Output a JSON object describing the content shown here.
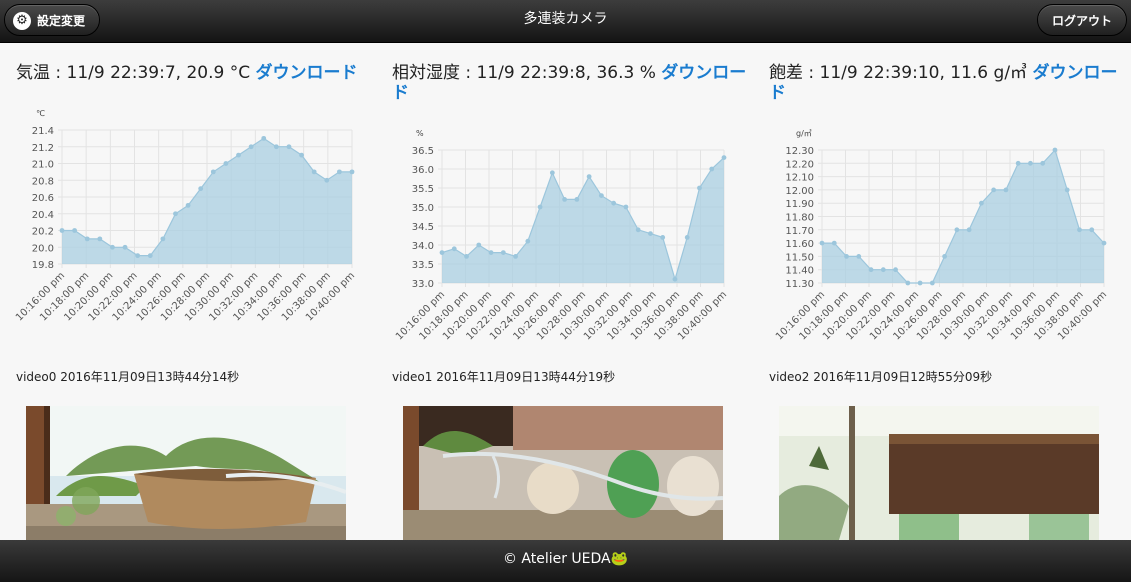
{
  "header": {
    "title": "多連装カメラ",
    "settings_label": "設定変更",
    "settings_icon": "gear-icon",
    "logout_label": "ログアウト"
  },
  "panels": [
    {
      "heading": "気温 : 11/9 22:39:7, 20.9 °C",
      "download_label": "ダウンロード",
      "video_label": "video0 2016年11月09日13時44分14秒"
    },
    {
      "heading": "相対湿度 : 11/9 22:39:8, 36.3 %",
      "download_label": "ダウンロード",
      "video_label": "video1 2016年11月09日13時44分19秒"
    },
    {
      "heading": "飽差 : 11/9 22:39:10, 11.6 g/㎥",
      "download_label": "ダウンロード",
      "video_label": "video2 2016年11月09日12時55分09秒"
    }
  ],
  "chart_data": [
    {
      "type": "area",
      "unit": "℃",
      "x_ticks": [
        "10:16:00 pm",
        "10:18:00 pm",
        "10:20:00 pm",
        "10:22:00 pm",
        "10:24:00 pm",
        "10:26:00 pm",
        "10:28:00 pm",
        "10:30:00 pm",
        "10:32:00 pm",
        "10:34:00 pm",
        "10:36:00 pm",
        "10:38:00 pm",
        "10:40:00 pm"
      ],
      "ylim": [
        19.8,
        21.4
      ],
      "y_ticks": [
        "19.8",
        "20.0",
        "20.2",
        "20.4",
        "20.6",
        "20.8",
        "21.0",
        "21.2",
        "21.4"
      ],
      "values": [
        20.2,
        20.2,
        20.1,
        20.1,
        20.0,
        20.0,
        19.9,
        19.9,
        20.1,
        20.4,
        20.5,
        20.7,
        20.9,
        21.0,
        21.1,
        21.2,
        21.3,
        21.2,
        21.2,
        21.1,
        20.9,
        20.8,
        20.9,
        20.9
      ],
      "color": "#a9cfe1"
    },
    {
      "type": "area",
      "unit": "%",
      "x_ticks": [
        "10:16:00 pm",
        "10:18:00 pm",
        "10:20:00 pm",
        "10:22:00 pm",
        "10:24:00 pm",
        "10:26:00 pm",
        "10:28:00 pm",
        "10:30:00 pm",
        "10:32:00 pm",
        "10:34:00 pm",
        "10:36:00 pm",
        "10:38:00 pm",
        "10:40:00 pm"
      ],
      "ylim": [
        33.0,
        36.5
      ],
      "y_ticks": [
        "33.0",
        "33.5",
        "34.0",
        "34.5",
        "35.0",
        "35.5",
        "36.0",
        "36.5"
      ],
      "values": [
        33.8,
        33.9,
        33.7,
        34.0,
        33.8,
        33.8,
        33.7,
        34.1,
        35.0,
        35.9,
        35.2,
        35.2,
        35.8,
        35.3,
        35.1,
        35.0,
        34.4,
        34.3,
        34.2,
        33.1,
        34.2,
        35.5,
        36.0,
        36.3
      ],
      "color": "#a9cfe1"
    },
    {
      "type": "area",
      "unit": "g/㎥",
      "x_ticks": [
        "10:16:00 pm",
        "10:18:00 pm",
        "10:20:00 pm",
        "10:22:00 pm",
        "10:24:00 pm",
        "10:26:00 pm",
        "10:28:00 pm",
        "10:30:00 pm",
        "10:32:00 pm",
        "10:34:00 pm",
        "10:36:00 pm",
        "10:38:00 pm",
        "10:40:00 pm"
      ],
      "ylim": [
        11.3,
        12.3
      ],
      "y_ticks": [
        "11.30",
        "11.40",
        "11.50",
        "11.60",
        "11.70",
        "11.80",
        "11.90",
        "12.00",
        "12.10",
        "12.20",
        "12.30"
      ],
      "values": [
        11.6,
        11.6,
        11.5,
        11.5,
        11.4,
        11.4,
        11.4,
        11.3,
        11.3,
        11.3,
        11.5,
        11.7,
        11.7,
        11.9,
        12.0,
        12.0,
        12.2,
        12.2,
        12.2,
        12.3,
        12.0,
        11.7,
        11.7,
        11.6
      ],
      "color": "#a9cfe1"
    }
  ],
  "footer": {
    "copyright": "© Atelier UEDA",
    "frog_icon": "🐸"
  }
}
